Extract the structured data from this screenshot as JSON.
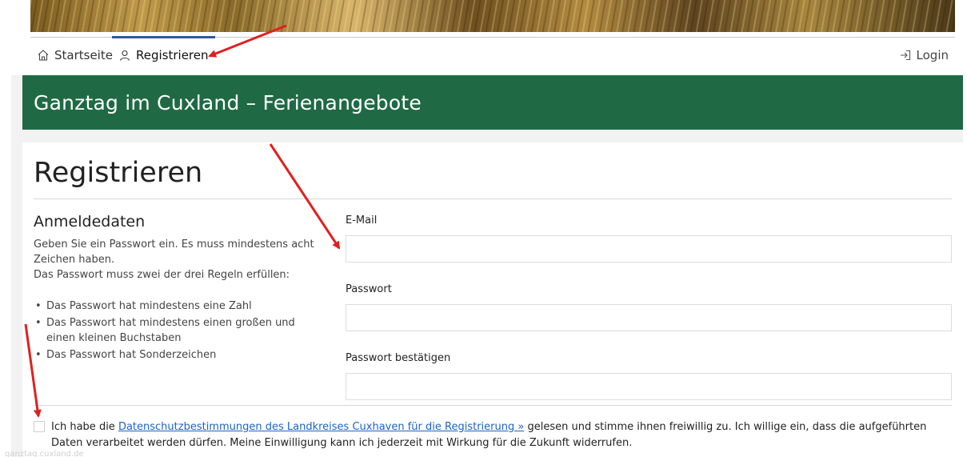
{
  "nav": {
    "home_label": "Startseite",
    "register_label": "Registrieren",
    "login_label": "Login"
  },
  "hero": {
    "title": "Ganztag im Cuxland – Ferienangebote"
  },
  "page": {
    "title": "Registrieren"
  },
  "credentials": {
    "heading": "Anmeldedaten",
    "help_1": "Geben Sie ein Passwort ein. Es muss mindestens acht Zeichen haben.",
    "help_2": "Das Passwort muss zwei der drei Regeln erfüllen:",
    "rules": [
      "Das Passwort hat mindestens eine Zahl",
      "Das Passwort hat mindestens einen großen und einen kleinen Buchstaben",
      "Das Passwort hat Sonderzeichen"
    ]
  },
  "form": {
    "email_label": "E-Mail",
    "email_value": "",
    "password_label": "Passwort",
    "password_value": "",
    "confirm_label": "Passwort bestätigen",
    "confirm_value": ""
  },
  "consent": {
    "prefix": "Ich habe die ",
    "link_text": "Datenschutzbestimmungen des Landkreises Cuxhaven für die Registrierung »",
    "suffix": " gelesen und stimme ihnen freiwillig zu. Ich willige ein, dass die aufgeführten Daten verarbeitet werden dürfen. Meine Einwilligung kann ich jederzeit mit Wirkung für die Zukunft widerrufen.",
    "checked": false
  },
  "footer": {
    "faint_text": "ganztag.cuxland.de"
  },
  "colors": {
    "hero_green": "#1f6a45",
    "active_tab": "#2f5a9e",
    "link_blue": "#1a63c9",
    "annotation_red": "#e02020"
  },
  "icons": {
    "home": "home-icon",
    "user": "user-icon",
    "login": "login-icon"
  }
}
